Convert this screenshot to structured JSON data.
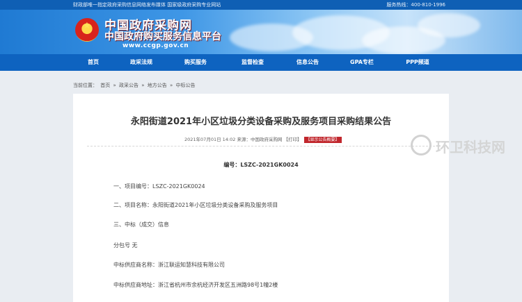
{
  "topbar": {
    "left_text": "财政部唯一指定政府采购信息网络发布媒体  国家级政府采购专业网站",
    "right_text": "服务热线：400-810-1996"
  },
  "header": {
    "title_cn": "中国政府采购网",
    "subtitle_cn": "中国政府购买服务信息平台",
    "url": "www.ccgp.gov.cn"
  },
  "nav": {
    "items": [
      "首页",
      "政采法规",
      "购买服务",
      "监督检查",
      "信息公告",
      "GPA专栏",
      "PPP频道"
    ]
  },
  "breadcrumb": {
    "prefix": "当前位置：",
    "items": [
      "首页",
      "政采公告",
      "地方公告",
      "中标公告"
    ],
    "separator": "»"
  },
  "article": {
    "title": "永阳街道2021年小区垃圾分类设备采购及服务项目采购结果公告",
    "meta": "2021年07月01日 14:02 来源：中国政府采购网 【打印】",
    "summary_tag": "【显示公告概要】",
    "number": "编号：LSZC-2021GK0024",
    "lines": [
      "一、项目编号：LSZC-2021GK0024",
      "二、项目名称：永阳街道2021年小区垃圾分类设备采购及服务项目",
      "三、中标（成交）信息",
      "分包号 无",
      "中标供应商名称：浙江联运知慧科技有限公司",
      "中标供应商地址：浙江省杭州市余杭经济开发区五洲路98号1幢2楼"
    ]
  },
  "watermark": {
    "text": "环卫科技网"
  }
}
